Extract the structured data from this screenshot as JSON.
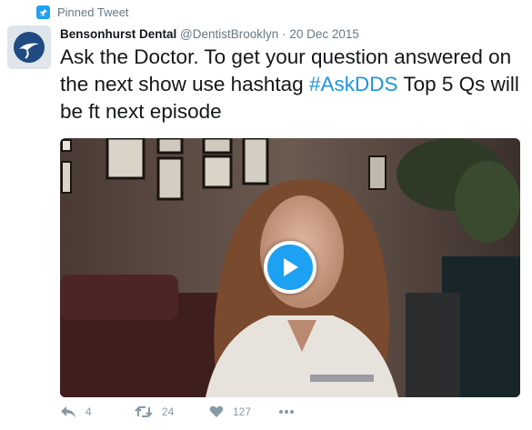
{
  "pinned": {
    "label": "Pinned Tweet",
    "icon": "pin-icon"
  },
  "author": {
    "name": "Bensonhurst Dental",
    "handle": "@DentistBrooklyn",
    "separator": "·",
    "date": "20 Dec 2015",
    "avatar_icon": "tooth-logo-icon"
  },
  "tweet": {
    "text_before": "Ask the Doctor. To get your question answered on the next show use hashtag ",
    "hashtag": "#AskDDS",
    "text_after": " Top 5 Qs will be ft next episode"
  },
  "media": {
    "type": "video",
    "play_icon": "play-icon"
  },
  "actions": {
    "reply_count": "4",
    "retweet_count": "24",
    "like_count": "127",
    "more_icon": "more-icon"
  },
  "colors": {
    "accent": "#1da1f2",
    "hashtag": "#1b95e0",
    "muted": "#657786",
    "action": "#8899a6"
  }
}
